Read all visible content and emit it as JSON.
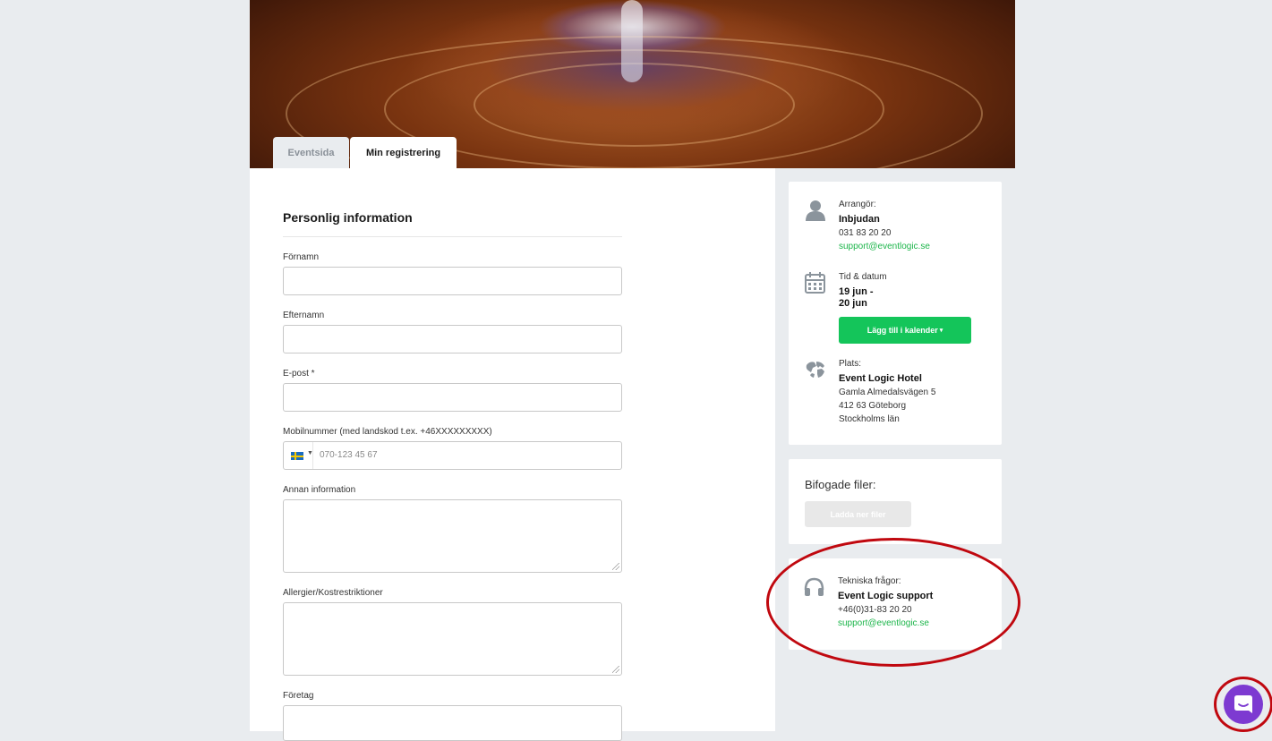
{
  "tabs": [
    {
      "label": "Eventsida",
      "active": false
    },
    {
      "label": "Min registrering",
      "active": true
    }
  ],
  "form": {
    "section_title": "Personlig information",
    "fields": {
      "first_name_label": "Förnamn",
      "last_name_label": "Efternamn",
      "email_label": "E-post *",
      "mobile_label": "Mobilnummer (med landskod t.ex. +46XXXXXXXXX)",
      "mobile_placeholder": "070-123 45 67",
      "other_info_label": "Annan information",
      "allergies_label": "Allergier/Kostrestriktioner",
      "company_label": "Företag"
    }
  },
  "sidebar": {
    "organizer": {
      "label": "Arrangör:",
      "name": "Inbjudan",
      "phone": "031 83 20 20",
      "email": "support@eventlogic.se"
    },
    "datetime": {
      "label": "Tid & datum",
      "start": "19 jun -",
      "end": "20 jun",
      "calendar_button": "Lägg till i kalender",
      "calendar_caret": "▾"
    },
    "location": {
      "label": "Plats:",
      "name": "Event Logic Hotel",
      "street": "Gamla Almedalsvägen 5",
      "city": "412 63 Göteborg",
      "region": "Stockholms län"
    },
    "files": {
      "title": "Bifogade filer:",
      "download_button": "Ladda ner filer"
    },
    "support": {
      "label": "Tekniska frågor:",
      "name": "Event Logic support",
      "phone": "+46(0)31-83 20 20",
      "email": "support@eventlogic.se"
    }
  },
  "colors": {
    "accent_green": "#14c55a",
    "link_green": "#1cb54a",
    "highlight_red": "#c0080f",
    "chat_purple": "#7d3ad1"
  },
  "icons": {
    "organizer": "person-icon",
    "datetime": "calendar-icon",
    "location": "globe-icon",
    "support": "headphones-icon",
    "chat": "chat-bubble-icon",
    "flag": "sweden-flag-icon"
  }
}
